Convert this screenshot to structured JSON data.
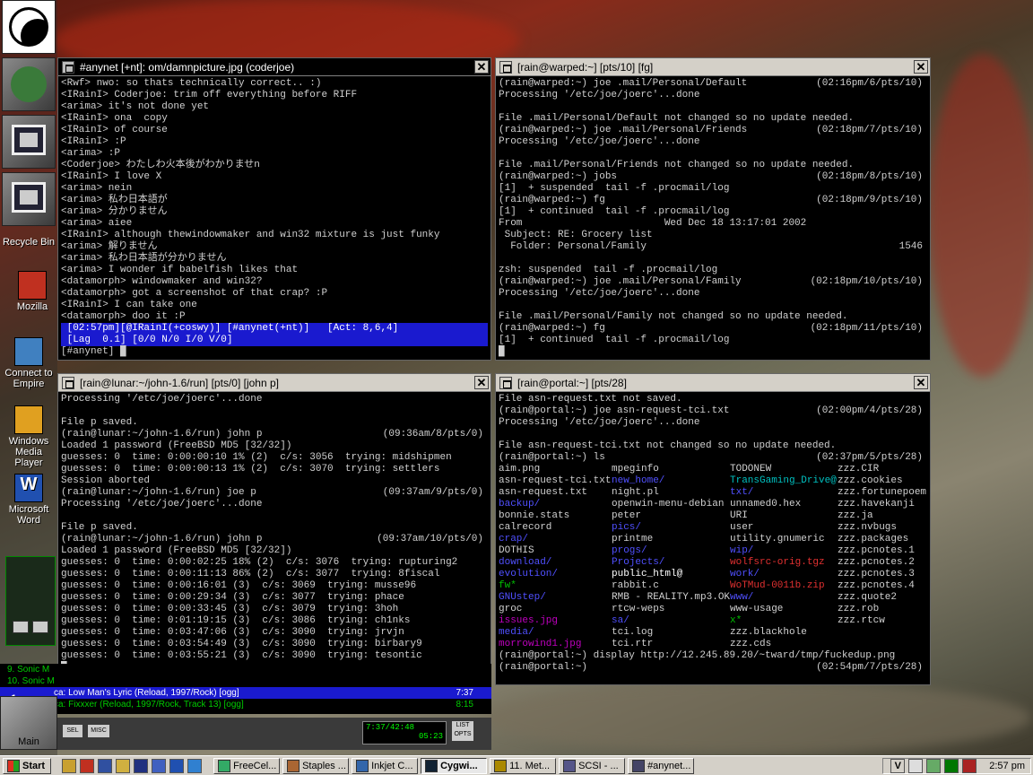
{
  "desktop": {
    "icons": [
      {
        "label": "Recycle Bin"
      },
      {
        "label": "Mozilla"
      },
      {
        "label": "Connect to Empire"
      },
      {
        "label": "Windows Media Player"
      },
      {
        "label": "Microsoft Word"
      }
    ],
    "dock_bottom_label": "Main"
  },
  "irc": {
    "title": "#anynet [+nt]: om/damnpicture.jpg (coderjoe)",
    "lines": [
      "<Rwf> nwo: so thats technically correct.. :)",
      "<IRainI> Coderjoe: trim off everything before RIFF",
      "<arima> it's not done yet",
      "<IRainI> ona  copy",
      "<IRainI> of course",
      "<IRainI> :P",
      "<arima> :P",
      "<Coderjoe> わたしわ火本後がわかりませn",
      "<IRainI> I love X",
      "<arima> nein",
      "<arima> 私わ日本語が",
      "<arima> 分かりません",
      "<arima> aiee",
      "<IRainI> although thewindowmaker and win32 mixture is just funky",
      "<arima> 解りません",
      "<arima> 私わ日本語が分かりません",
      "<arima> I wonder if babelfish likes that",
      "<datamorph> windowmaker and win32?",
      "<datamorph> got a screenshot of that crap? :P",
      "<IRainI> I can take one",
      "<datamorph> doo it :P"
    ],
    "status1": " [02:57pm][@IRainI(+coswy)] [#anynet(+nt)]   [Act: 8,6,4]",
    "status2": " [Lag  0.1] [0/0 N/0 I/0 V/0]",
    "input": "[#anynet]"
  },
  "warped": {
    "title": "[rain@warped:~] [pts/10] [fg]",
    "lines": [
      {
        "t": "(rain@warped:~) joe .mail/Personal/Default",
        "r": "(02:16pm/6/pts/10)"
      },
      {
        "t": "Processing '/etc/joe/joerc'...done",
        "r": ""
      },
      {
        "t": "",
        "r": ""
      },
      {
        "t": "File .mail/Personal/Default not changed so no update needed.",
        "r": ""
      },
      {
        "t": "(rain@warped:~) joe .mail/Personal/Friends",
        "r": "(02:18pm/7/pts/10)"
      },
      {
        "t": "Processing '/etc/joe/joerc'...done",
        "r": ""
      },
      {
        "t": "",
        "r": ""
      },
      {
        "t": "File .mail/Personal/Friends not changed so no update needed.",
        "r": ""
      },
      {
        "t": "(rain@warped:~) jobs",
        "r": "(02:18pm/8/pts/10)"
      },
      {
        "t": "[1]  + suspended  tail -f .procmail/log",
        "r": ""
      },
      {
        "t": "(rain@warped:~) fg",
        "r": "(02:18pm/9/pts/10)"
      },
      {
        "t": "[1]  + continued  tail -f .procmail/log",
        "r": ""
      },
      {
        "t": "From                        Wed Dec 18 13:17:01 2002",
        "r": ""
      },
      {
        "t": " Subject: RE: Grocery list",
        "r": ""
      },
      {
        "t": "  Folder: Personal/Family",
        "r": "1546"
      },
      {
        "t": "",
        "r": ""
      },
      {
        "t": "zsh: suspended  tail -f .procmail/log",
        "r": ""
      },
      {
        "t": "(rain@warped:~) joe .mail/Personal/Family",
        "r": "(02:18pm/10/pts/10)"
      },
      {
        "t": "Processing '/etc/joe/joerc'...done",
        "r": ""
      },
      {
        "t": "",
        "r": ""
      },
      {
        "t": "File .mail/Personal/Family not changed so no update needed.",
        "r": ""
      },
      {
        "t": "(rain@warped:~) fg",
        "r": "(02:18pm/11/pts/10)"
      },
      {
        "t": "[1]  + continued  tail -f .procmail/log",
        "r": ""
      }
    ]
  },
  "lunar": {
    "title": "[rain@lunar:~/john-1.6/run] [pts/0] [john p]",
    "lines": [
      {
        "t": "Processing '/etc/joe/joerc'...done",
        "r": ""
      },
      {
        "t": "",
        "r": ""
      },
      {
        "t": "File p saved.",
        "r": ""
      },
      {
        "t": "(rain@lunar:~/john-1.6/run) john p",
        "r": "(09:36am/8/pts/0)"
      },
      {
        "t": "Loaded 1 password (FreeBSD MD5 [32/32])",
        "r": ""
      },
      {
        "t": "guesses: 0  time: 0:00:00:10 1% (2)  c/s: 3056  trying: midshipmen",
        "r": ""
      },
      {
        "t": "guesses: 0  time: 0:00:00:13 1% (2)  c/s: 3070  trying: settlers",
        "r": ""
      },
      {
        "t": "Session aborted",
        "r": ""
      },
      {
        "t": "(rain@lunar:~/john-1.6/run) joe p",
        "r": "(09:37am/9/pts/0)"
      },
      {
        "t": "Processing '/etc/joe/joerc'...done",
        "r": ""
      },
      {
        "t": "",
        "r": ""
      },
      {
        "t": "File p saved.",
        "r": ""
      },
      {
        "t": "(rain@lunar:~/john-1.6/run) john p",
        "r": "(09:37am/10/pts/0)"
      },
      {
        "t": "Loaded 1 password (FreeBSD MD5 [32/32])",
        "r": ""
      },
      {
        "t": "guesses: 0  time: 0:00:02:25 18% (2)  c/s: 3076  trying: rupturing2",
        "r": ""
      },
      {
        "t": "guesses: 0  time: 0:00:11:13 86% (2)  c/s: 3077  trying: 8fiscal",
        "r": ""
      },
      {
        "t": "guesses: 0  time: 0:00:16:01 (3)  c/s: 3069  trying: musse96",
        "r": ""
      },
      {
        "t": "guesses: 0  time: 0:00:29:34 (3)  c/s: 3077  trying: phace",
        "r": ""
      },
      {
        "t": "guesses: 0  time: 0:00:33:45 (3)  c/s: 3079  trying: 3hoh",
        "r": ""
      },
      {
        "t": "guesses: 0  time: 0:01:19:15 (3)  c/s: 3086  trying: ch1nks",
        "r": ""
      },
      {
        "t": "guesses: 0  time: 0:03:47:06 (3)  c/s: 3090  trying: jrvjn",
        "r": ""
      },
      {
        "t": "guesses: 0  time: 0:03:54:49 (3)  c/s: 3090  trying: birbary9",
        "r": ""
      },
      {
        "t": "guesses: 0  time: 0:03:55:21 (3)  c/s: 3090  trying: tesontic",
        "r": ""
      }
    ]
  },
  "portal": {
    "title": "[rain@portal:~] [pts/28]",
    "head": [
      {
        "t": "File asn-request.txt not saved.",
        "r": ""
      },
      {
        "t": "(rain@portal:~) joe asn-request-tci.txt",
        "r": "(02:00pm/4/pts/28)"
      },
      {
        "t": "Processing '/etc/joe/joerc'...done",
        "r": ""
      },
      {
        "t": "",
        "r": ""
      },
      {
        "t": "File asn-request-tci.txt not changed so no update needed.",
        "r": ""
      },
      {
        "t": "(rain@portal:~) ls",
        "r": "(02:37pm/5/pts/28)"
      }
    ],
    "ls": [
      [
        {
          "t": "aim.png",
          "c": ""
        },
        {
          "t": "mpeginfo",
          "c": ""
        },
        {
          "t": "TODONEW",
          "c": ""
        },
        {
          "t": "zzz.CIR",
          "c": ""
        }
      ],
      [
        {
          "t": "asn-request-tci.txt",
          "c": ""
        },
        {
          "t": "new_home/",
          "c": "blue"
        },
        {
          "t": "TransGaming_Drive@",
          "c": "cyan"
        },
        {
          "t": "zzz.cookies",
          "c": ""
        }
      ],
      [
        {
          "t": "asn-request.txt",
          "c": ""
        },
        {
          "t": "night.pl",
          "c": ""
        },
        {
          "t": "txt/",
          "c": "blue"
        },
        {
          "t": "zzz.fortunepoem",
          "c": ""
        }
      ],
      [
        {
          "t": "backup/",
          "c": "blue"
        },
        {
          "t": "openwin-menu-debian",
          "c": ""
        },
        {
          "t": "unnamed0.hex",
          "c": ""
        },
        {
          "t": "zzz.havekanji",
          "c": ""
        }
      ],
      [
        {
          "t": "bonnie.stats",
          "c": ""
        },
        {
          "t": "peter",
          "c": ""
        },
        {
          "t": "URI",
          "c": ""
        },
        {
          "t": "zzz.ja",
          "c": ""
        }
      ],
      [
        {
          "t": "calrecord",
          "c": ""
        },
        {
          "t": "pics/",
          "c": "blue"
        },
        {
          "t": "user",
          "c": ""
        },
        {
          "t": "zzz.nvbugs",
          "c": ""
        }
      ],
      [
        {
          "t": "crap/",
          "c": "blue"
        },
        {
          "t": "printme",
          "c": ""
        },
        {
          "t": "utility.gnumeric",
          "c": ""
        },
        {
          "t": "zzz.packages",
          "c": ""
        }
      ],
      [
        {
          "t": "DOTHIS",
          "c": ""
        },
        {
          "t": "progs/",
          "c": "blue"
        },
        {
          "t": "wip/",
          "c": "blue"
        },
        {
          "t": "zzz.pcnotes.1",
          "c": ""
        }
      ],
      [
        {
          "t": "download/",
          "c": "blue"
        },
        {
          "t": "Projects/",
          "c": "blue"
        },
        {
          "t": "wolfsrc-orig.tgz",
          "c": "red"
        },
        {
          "t": "zzz.pcnotes.2",
          "c": ""
        }
      ],
      [
        {
          "t": "evolution/",
          "c": "blue"
        },
        {
          "t": "public_html@",
          "c": "wht"
        },
        {
          "t": "work/",
          "c": "blue"
        },
        {
          "t": "zzz.pcnotes.3",
          "c": ""
        }
      ],
      [
        {
          "t": "fw*",
          "c": "grn"
        },
        {
          "t": "rabbit.c",
          "c": ""
        },
        {
          "t": "WoTMud-0011b.zip",
          "c": "red"
        },
        {
          "t": "zzz.pcnotes.4",
          "c": ""
        }
      ],
      [
        {
          "t": "GNUstep/",
          "c": "blue"
        },
        {
          "t": "RMB - REALITY.mp3.OK",
          "c": ""
        },
        {
          "t": "www/",
          "c": "blue"
        },
        {
          "t": "zzz.quote2",
          "c": ""
        }
      ],
      [
        {
          "t": "groc",
          "c": ""
        },
        {
          "t": "rtcw-weps",
          "c": ""
        },
        {
          "t": "www-usage",
          "c": ""
        },
        {
          "t": "zzz.rob",
          "c": ""
        }
      ],
      [
        {
          "t": "issues.jpg",
          "c": "mag"
        },
        {
          "t": "sa/",
          "c": "blue"
        },
        {
          "t": "x*",
          "c": "grn"
        },
        {
          "t": "zzz.rtcw",
          "c": ""
        }
      ],
      [
        {
          "t": "media/",
          "c": "blue"
        },
        {
          "t": "tci.log",
          "c": ""
        },
        {
          "t": "zzz.blackhole",
          "c": ""
        },
        {
          "t": "",
          "c": ""
        }
      ],
      [
        {
          "t": "morrowind1.jpg",
          "c": "mag"
        },
        {
          "t": "tci.rtr",
          "c": ""
        },
        {
          "t": "zzz.cds",
          "c": ""
        },
        {
          "t": "",
          "c": ""
        }
      ]
    ],
    "tail": [
      {
        "t": "(rain@portal:~) display http://12.245.89.20/~tward/tmp/fuckedup.png",
        "r": ""
      },
      {
        "t": "(rain@portal:~) ",
        "r": "(02:54pm/7/pts/28)"
      }
    ]
  },
  "player": {
    "playlist": [
      "9. Sonic M",
      "10. Sonic M",
      "ca: Low Man's Lyric (Reload, 1997/Rock) [ogg]",
      "ca: Fixxxer (Reload, 1997/Rock, Track 13) [ogg]"
    ],
    "times": [
      "",
      "",
      "7:37",
      "8:15"
    ],
    "track_num": "1",
    "btn_sel": "SEL",
    "btn_misc": "MISC",
    "time_display": "7:37/42:48",
    "time_small": "05:23",
    "list_btn": "LIST OPTS"
  },
  "taskbar": {
    "start": "Start",
    "tasks": [
      "FreeCel...",
      "Staples ...",
      "Inkjet C...",
      "Cygwi...",
      "11. Met...",
      "SCSI - ...",
      "#anynet..."
    ],
    "clock": "2:57 pm",
    "tray_letter": "V"
  }
}
